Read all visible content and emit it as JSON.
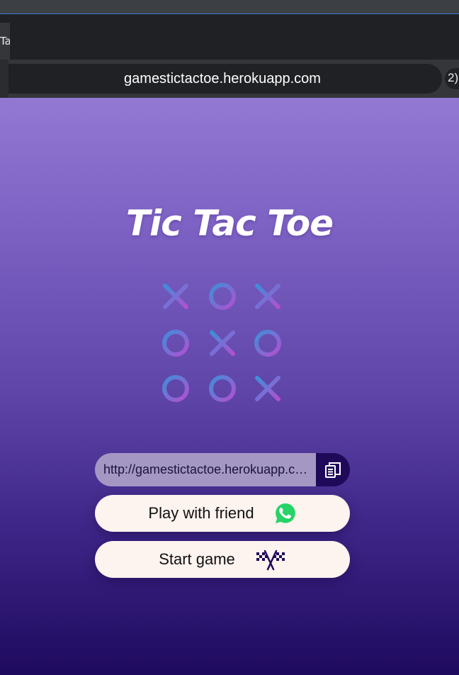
{
  "browser": {
    "tab_fragment": "Ta",
    "url": "gamestictactoe.herokuapp.com",
    "extension_badge": "2)"
  },
  "page": {
    "title": "Tic Tac Toe",
    "board_pattern": [
      "X",
      "O",
      "X",
      "O",
      "X",
      "O",
      "O",
      "O",
      "X"
    ],
    "share_link": {
      "value": "http://gamestictactoe.herokuapp.com/"
    },
    "play_with_friend_label": "Play with friend",
    "start_game_label": "Start game",
    "icons": {
      "copy": "copy-icon",
      "share": "whatsapp-icon",
      "start": "checkered-flags-icon"
    }
  },
  "colors": {
    "gradient_top": "#9378d3",
    "gradient_bottom": "#1e0a5e",
    "button_bg": "#fdf3ef",
    "copy_button_bg": "#1f0a5a",
    "whatsapp_green": "#25d366",
    "board_blue": "#3d8fd9",
    "board_pink": "#b34fd1"
  }
}
